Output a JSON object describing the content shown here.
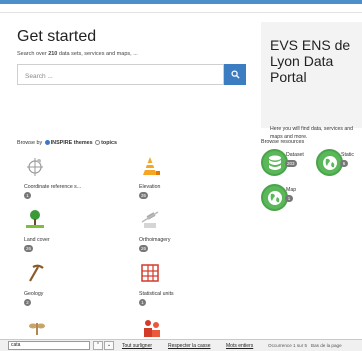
{
  "header": {
    "title": "Get started",
    "subtitle_prefix": "Search over ",
    "subtitle_count": "210",
    "subtitle_suffix": " data sets, services and maps, ..."
  },
  "search": {
    "placeholder": "Search ..."
  },
  "portal": {
    "title": "EVS ENS de Lyon Data Portal",
    "description": "Here you will find data, services and maps and more."
  },
  "browse": {
    "label": "Browse by",
    "option_themes": "INSPIRE themes",
    "option_topics": "topics",
    "themes": [
      {
        "label": "Coordinate reference s...",
        "count": "1",
        "icon": "coordinate-reference-icon"
      },
      {
        "label": "Elevation",
        "count": "35",
        "icon": "elevation-icon"
      },
      {
        "label": "Land cover",
        "count": "26",
        "icon": "land-cover-icon"
      },
      {
        "label": "Orthoimagery",
        "count": "26",
        "icon": "orthoimagery-icon"
      },
      {
        "label": "Geology",
        "count": "2",
        "icon": "geology-icon"
      },
      {
        "label": "Statistical units",
        "count": "1",
        "icon": "statistical-units-icon"
      },
      {
        "label": "",
        "count": "",
        "icon": "plant-icon"
      },
      {
        "label": "",
        "count": "",
        "icon": "population-icon"
      }
    ]
  },
  "resources": {
    "title": "Browse resources",
    "items": [
      {
        "label": "Dataset",
        "count": "203",
        "icon": "database-icon"
      },
      {
        "label": "Static",
        "count": "6",
        "icon": "globe-icon"
      },
      {
        "label": "Map",
        "count": "1",
        "icon": "globe-icon"
      }
    ]
  },
  "findbar": {
    "query": "cata",
    "prev": "⌃",
    "next": "⌄",
    "highlight_all": "Tout surligner",
    "match_case": "Respecter la casse",
    "whole_words": "Mots entiers",
    "occurrence": "Occurrence 1 sur 5",
    "bottom_reached": "Bas de la page"
  },
  "colors": {
    "accent": "#3c7dc1",
    "resource_green": "#5bb85a",
    "theme_orange": "#f08a00"
  }
}
